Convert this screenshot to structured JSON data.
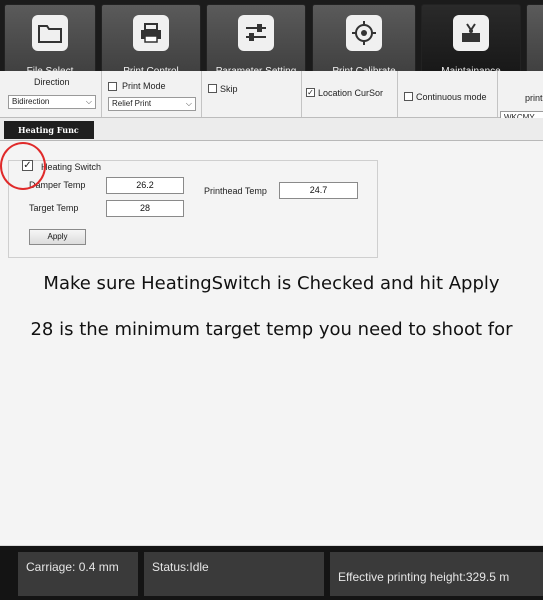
{
  "toolbar": {
    "buttons": [
      {
        "label": "File Select",
        "icon": "folder-icon"
      },
      {
        "label": "Print Control",
        "icon": "printer-icon"
      },
      {
        "label": "Parameter Setting",
        "icon": "sliders-icon"
      },
      {
        "label": "Print Calibrate",
        "icon": "crosshair-icon"
      },
      {
        "label": "Maintainance",
        "icon": "maintenance-icon"
      }
    ]
  },
  "params": {
    "direction_label": "Direction",
    "direction_value": "Bidirection",
    "print_mode_label": "Print Mode",
    "print_mode_value": "Relief Print",
    "skip_label": "Skip",
    "location_cursor_label": "Location CurSor",
    "continuous_mode_label": "Continuous mode",
    "print_label_partial": "print",
    "color_value": "WKCMY"
  },
  "tab": {
    "label": "Heating Func"
  },
  "heating": {
    "switch_label": "Heating Switch",
    "damper_temp_label": "Damper Temp",
    "damper_temp_value": "26.2",
    "printhead_temp_label": "Printhead Temp",
    "printhead_temp_value": "24.7",
    "target_temp_label": "Target Temp",
    "target_temp_value": "28",
    "apply_label": "Apply"
  },
  "overlay": {
    "line1": "Make sure HeatingSwitch is Checked and hit Apply",
    "line2": "28 is the minimum target temp you need to shoot for"
  },
  "status": {
    "carriage": "Carriage: 0.4 mm",
    "status": "Status:Idle",
    "effective_height": "Effective printing height:329.5 m"
  },
  "colors": {
    "annotation_circle": "#e02a2a"
  }
}
